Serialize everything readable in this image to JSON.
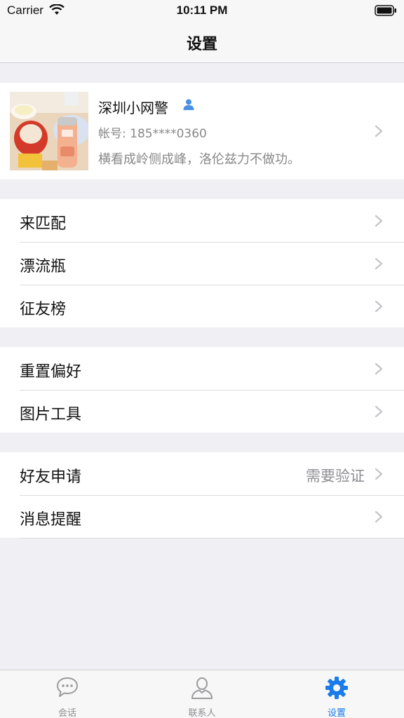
{
  "status_bar": {
    "carrier": "Carrier",
    "time": "10:11 PM"
  },
  "nav": {
    "title": "设置"
  },
  "profile": {
    "name": "深圳小网警",
    "account": "帐号: 185****0360",
    "signature": "横看成岭侧成峰，洛伦兹力不做功。"
  },
  "groups": [
    {
      "items": [
        {
          "label": "来匹配"
        },
        {
          "label": "漂流瓶"
        },
        {
          "label": "征友榜"
        }
      ]
    },
    {
      "items": [
        {
          "label": "重置偏好"
        },
        {
          "label": "图片工具"
        }
      ]
    },
    {
      "items": [
        {
          "label": "好友申请",
          "value": "需要验证"
        },
        {
          "label": "消息提醒"
        }
      ]
    }
  ],
  "tabs": [
    {
      "label": "会话",
      "icon": "chat-bubble-icon",
      "active": false
    },
    {
      "label": "联系人",
      "icon": "person-icon",
      "active": false
    },
    {
      "label": "设置",
      "icon": "gear-icon",
      "active": true
    }
  ],
  "colors": {
    "accent": "#1a7bea",
    "background": "#efeff4",
    "secondary_text": "#8e8e93"
  }
}
